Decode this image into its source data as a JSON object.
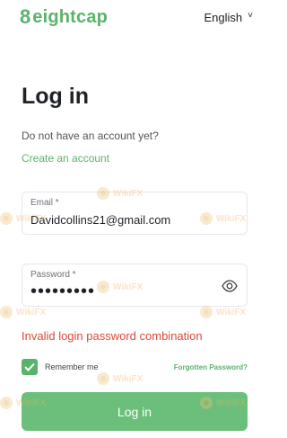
{
  "header": {
    "logo_text": "eightcap",
    "language": "English"
  },
  "page": {
    "title": "Log in",
    "subtitle": "Do not have an account yet?",
    "create_account_link": "Create an account"
  },
  "form": {
    "email": {
      "label": "Email *",
      "value": "Davidcollins21@gmail.com"
    },
    "password": {
      "label": "Password *",
      "masked_value": "•••••••••"
    },
    "error_message": "Invalid login password combination",
    "remember_label": "Remember me",
    "forgot_link": "Forgotten Password?",
    "submit_label": "Log in"
  },
  "watermark": {
    "text": "WikiFX"
  },
  "colors": {
    "brand_green": "#5ab36b",
    "button_green": "#6bbf7a",
    "error_red": "#d84a3a"
  }
}
